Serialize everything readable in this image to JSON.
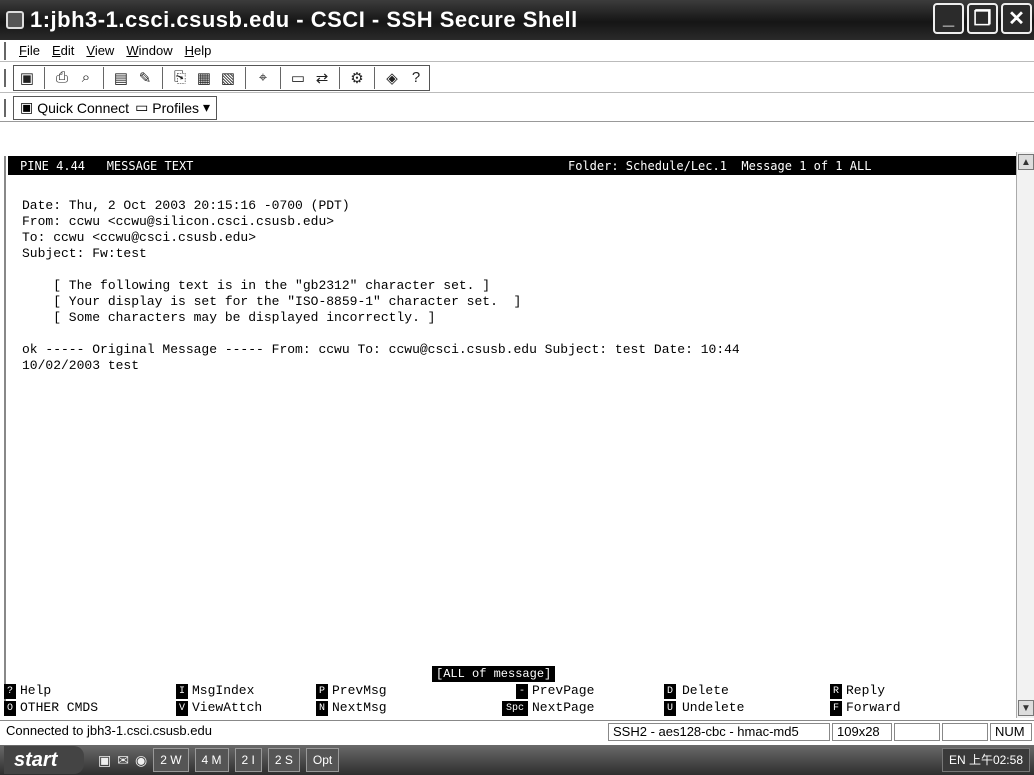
{
  "window": {
    "title": "1:jbh3-1.csci.csusb.edu - CSCI - SSH Secure Shell"
  },
  "menu": [
    "File",
    "Edit",
    "View",
    "Window",
    "Help"
  ],
  "quickbar": {
    "quick_connect": "Quick Connect",
    "profiles": "Profiles"
  },
  "pine": {
    "header_left": "PINE 4.44   MESSAGE TEXT",
    "header_right": "Folder: Schedule/Lec.1  Message 1 of 1 ALL",
    "lines": [
      "Date: Thu, 2 Oct 2003 20:15:16 -0700 (PDT)",
      "From: ccwu <ccwu@silicon.csci.csusb.edu>",
      "To: ccwu <ccwu@csci.csusb.edu>",
      "Subject: Fw:test",
      "    [ The following text is in the \"gb2312\" character set. ]",
      "    [ Your display is set for the \"ISO-8859-1\" character set.  ]",
      "    [ Some characters may be displayed incorrectly. ]",
      "ok ----- Original Message ----- From: ccwu To: ccwu@csci.csusb.edu Subject: test Date: 10:44",
      "10/02/2003 test"
    ],
    "status": "[ALL of message]",
    "commands": [
      {
        "key": "?",
        "label": "Help"
      },
      {
        "key": "O",
        "label": "OTHER CMDS"
      },
      {
        "key": "I",
        "label": "MsgIndex"
      },
      {
        "key": "V",
        "label": "ViewAttch"
      },
      {
        "key": "P",
        "label": "PrevMsg"
      },
      {
        "key": "N",
        "label": "NextMsg"
      },
      {
        "key": "-",
        "label": "PrevPage"
      },
      {
        "key": "Spc",
        "label": "NextPage"
      },
      {
        "key": "D",
        "label": "Delete"
      },
      {
        "key": "U",
        "label": "Undelete"
      },
      {
        "key": "R",
        "label": "Reply"
      },
      {
        "key": "F",
        "label": "Forward"
      }
    ]
  },
  "statusbar": {
    "connection": "Connected to jbh3-1.csci.csusb.edu",
    "cipher": "SSH2 - aes128-cbc - hmac-md5",
    "size": "109x28",
    "num": "NUM"
  },
  "taskbar": {
    "start": "start",
    "buttons": [
      "2 W",
      "4 M",
      "2 I",
      "2 S",
      "Opt"
    ],
    "tray": "EN  上午02:58"
  }
}
